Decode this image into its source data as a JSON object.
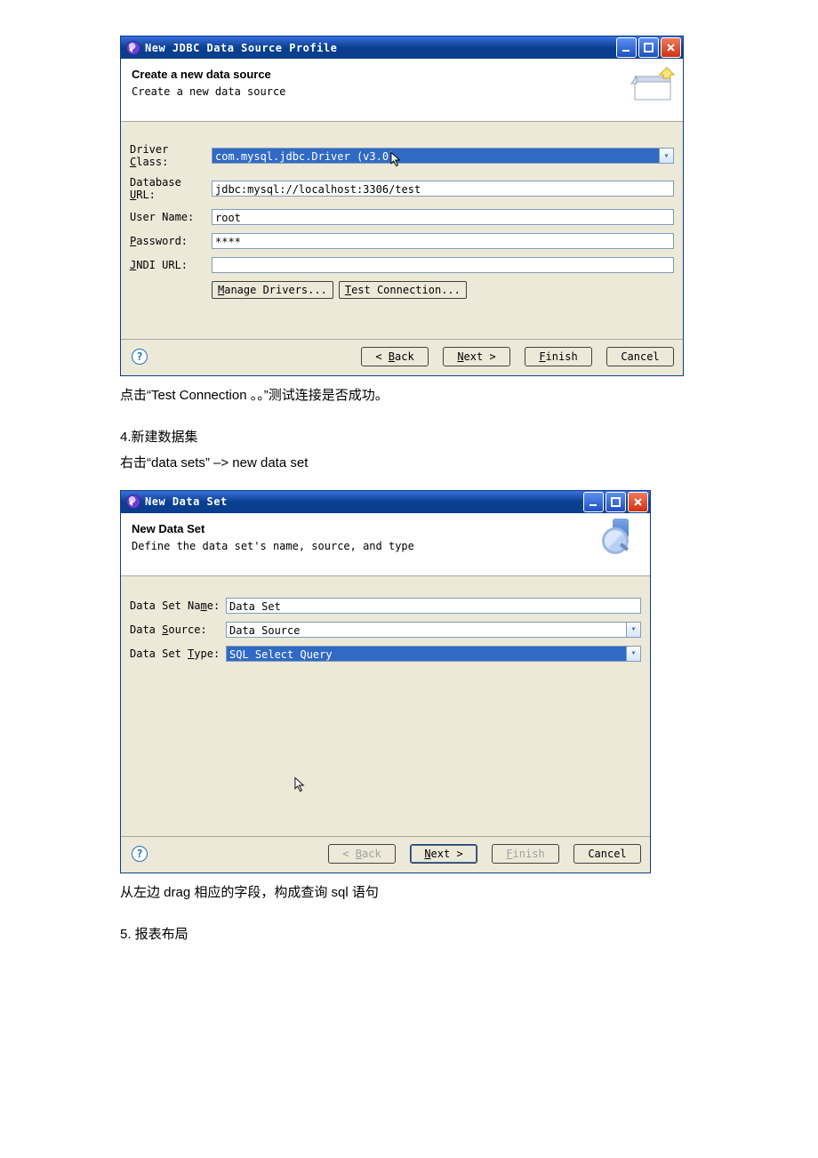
{
  "jdbc": {
    "window_title": "New JDBC Data Source Profile",
    "header_title": "Create a new data source",
    "header_sub": "Create a new data source",
    "labels": {
      "driver_class": "Driver Class:",
      "db_url": "Database URL:",
      "user": "User Name:",
      "password": "Password:",
      "jndi": "JNDI URL:"
    },
    "values": {
      "driver_class": "com.mysql.jdbc.Driver (v3.0)",
      "db_url": "jdbc:mysql://localhost:3306/test",
      "user": "root",
      "password": "****",
      "jndi": ""
    },
    "buttons": {
      "manage": "Manage Drivers...",
      "test": "Test Connection..."
    },
    "nav": {
      "back": "< Back",
      "next": "Next >",
      "finish": "Finish",
      "cancel": "Cancel"
    }
  },
  "narrative": {
    "line1": "点击“Test Connection  。。”测试连接是否成功。",
    "section4": "4.新建数据集",
    "line2": "右击“data sets”  –> new data set",
    "line3": "从左边 drag  相应的字段，构成查询 sql 语句",
    "section5": "5.    报表布局"
  },
  "dataset": {
    "window_title": "New Data Set",
    "header_title": "New Data Set",
    "header_sub": "Define the data set's name, source, and type",
    "labels": {
      "name": "Data Set Name:",
      "source": "Data Source:",
      "type": "Data Set Type:"
    },
    "values": {
      "name": "Data Set",
      "source": "Data Source",
      "type": "SQL Select Query"
    },
    "nav": {
      "back": "< Back",
      "next": "Next >",
      "finish": "Finish",
      "cancel": "Cancel"
    }
  }
}
